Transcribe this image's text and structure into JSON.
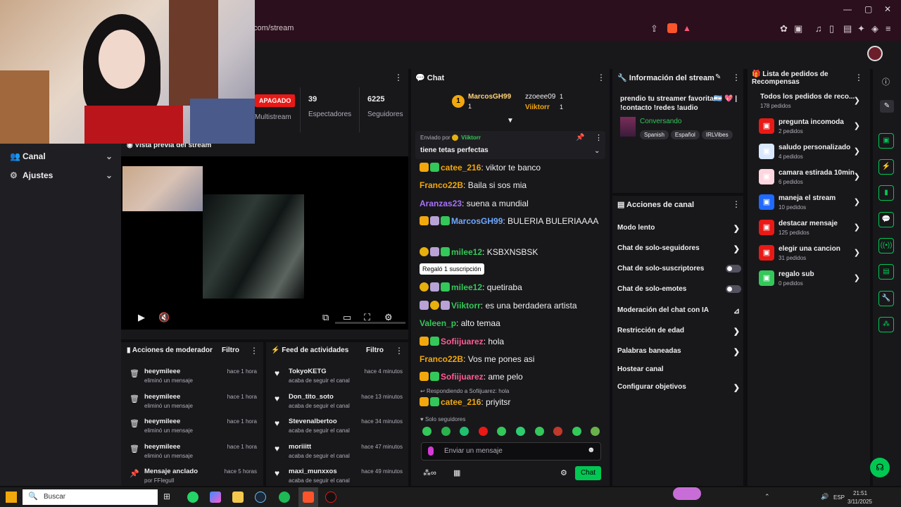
{
  "browser": {
    "url": "com/stream"
  },
  "leftnav": {
    "items": [
      {
        "label": "Canal"
      },
      {
        "label": "Ajustes"
      }
    ]
  },
  "stream_info_panel": {
    "status_badge": "APAGADO",
    "multistream_label": "Multistream",
    "viewers_value": "39",
    "viewers_label": "Espectadores",
    "followers_value": "6225",
    "followers_label": "Seguidores",
    "preview_label": "Vista previa del stream"
  },
  "mod_actions": {
    "title": "Acciones de moderador",
    "filter_label": "Filtro",
    "rows": [
      {
        "name": "heeymileee",
        "desc": "eliminó un mensaje",
        "time": "hace 1 hora"
      },
      {
        "name": "heeymileee",
        "desc": "eliminó un mensaje",
        "time": "hace 1 hora"
      },
      {
        "name": "heeymileee",
        "desc": "eliminó un mensaje",
        "time": "hace 1 hora"
      },
      {
        "name": "heeymileee",
        "desc": "eliminó un mensaje",
        "time": "hace 1 hora"
      },
      {
        "name": "Mensaje anclado",
        "desc": "por FFlegull",
        "time": "hace 5 horas"
      }
    ]
  },
  "activity_feed": {
    "title": "Feed de actividades",
    "filter_label": "Filtro",
    "rows": [
      {
        "name": "TokyoKETG",
        "desc": "acaba de seguir el canal",
        "time": "hace 4 minutos"
      },
      {
        "name": "Don_tito_soto",
        "desc": "acaba de seguir el canal",
        "time": "hace 13 minutos"
      },
      {
        "name": "Stevenalbertoo",
        "desc": "acaba de seguir el canal",
        "time": "hace 34 minutos"
      },
      {
        "name": "moriiitt",
        "desc": "acaba de seguir el canal",
        "time": "hace 47 minutos"
      },
      {
        "name": "maxi_munxxos",
        "desc": "acaba de seguir el canal",
        "time": "hace 49 minutos"
      }
    ]
  },
  "chat": {
    "title": "Chat",
    "top_gifters": [
      {
        "name": "MarcosGH99",
        "count": "1"
      },
      {
        "name": "zzoeee09",
        "count": "1"
      },
      {
        "name": "Viiktorr",
        "count": "1"
      }
    ],
    "pinned_by_label": "Enviado por",
    "pinned_user": "Viiktorr",
    "pinned_text": "tiene tetas perfectas",
    "messages": [
      {
        "user": "catee_216",
        "color": "#f2a70c",
        "text": "viktor te banco"
      },
      {
        "user": "Franco22B",
        "color": "#f2a70c",
        "text": "Baila si sos mia"
      },
      {
        "user": "Aranzas23",
        "color": "#a970ff",
        "text": "suena a mundial"
      },
      {
        "user": "MarcosGH99",
        "color": "#6fa8ff",
        "text": "BULERIA BULERIAAAA"
      },
      {
        "user": "milee12",
        "color": "#34c759",
        "text": "KSBXNSBSK"
      },
      {
        "user": "milee12",
        "color": "#34c759",
        "text": "quetiraba"
      },
      {
        "user": "Viiktorr",
        "color": "#34c759",
        "text": "es una berdadera artista"
      },
      {
        "user": "Valeen_p",
        "color": "#34c759",
        "text": "alto temaa"
      },
      {
        "user": "Sofiijuarez",
        "color": "#ff5c93",
        "text": "hola"
      },
      {
        "user": "Franco22B",
        "color": "#f2a70c",
        "text": "Vos me pones asi"
      },
      {
        "user": "Sofiijuarez",
        "color": "#ff5c93",
        "text": "ame pelo"
      },
      {
        "user": "catee_216",
        "color": "#f2a70c",
        "text": "priyitsr"
      }
    ],
    "tooltip": "Regaló 1 suscripción",
    "reply_label": "Respondiendo a Sofiijuarez: hola",
    "followers_only": "Solo seguidores",
    "input_placeholder": "Enviar un mensaje",
    "send_label": "Chat"
  },
  "stream_info": {
    "title": "Información del stream",
    "stream_title": "prendio tu streamer favorita🇦🇷 💖 | !contacto !redes !audio",
    "category": "Conversando",
    "tags": [
      "Spanish",
      "Español",
      "IRLVibes"
    ]
  },
  "channel_actions": {
    "title": "Acciones de canal",
    "rows": [
      {
        "label": "Modo lento",
        "kind": "chevron"
      },
      {
        "label": "Chat de solo-seguidores",
        "kind": "chevron"
      },
      {
        "label": "Chat de solo-suscriptores",
        "kind": "toggle"
      },
      {
        "label": "Chat de solo-emotes",
        "kind": "toggle"
      },
      {
        "label": "Moderación del chat con IA",
        "kind": "chart"
      },
      {
        "label": "Restricción de edad",
        "kind": "chevron"
      },
      {
        "label": "Palabras baneadas",
        "kind": "chevron"
      },
      {
        "label": "Hostear canal",
        "kind": "none"
      },
      {
        "label": "Configurar objetivos",
        "kind": "chevron"
      }
    ]
  },
  "rewards": {
    "title": "Lista de pedidos de Recompensas",
    "all_label": "Todos los pedidos de reco...",
    "all_count": "178 pedidos",
    "items": [
      {
        "label": "pregunta incomoda",
        "count": "2 pedidos",
        "color": "#e91916"
      },
      {
        "label": "saludo personalizado",
        "count": "4 pedidos",
        "color": "#d8e8ff"
      },
      {
        "label": "camara estirada 10min",
        "count": "6 pedidos",
        "color": "#ffd6e0"
      },
      {
        "label": "maneja el stream",
        "count": "10 pedidos",
        "color": "#1f69ff"
      },
      {
        "label": "destacar mensaje",
        "count": "125 pedidos",
        "color": "#e91916"
      },
      {
        "label": "elegir una cancion",
        "count": "31 pedidos",
        "color": "#e91916"
      },
      {
        "label": "regalo sub",
        "count": "0 pedidos",
        "color": "#34c759"
      }
    ]
  },
  "taskbar": {
    "search_label": "Buscar",
    "lang": "ESP",
    "time": "21:51",
    "date": "3/11/2025"
  }
}
